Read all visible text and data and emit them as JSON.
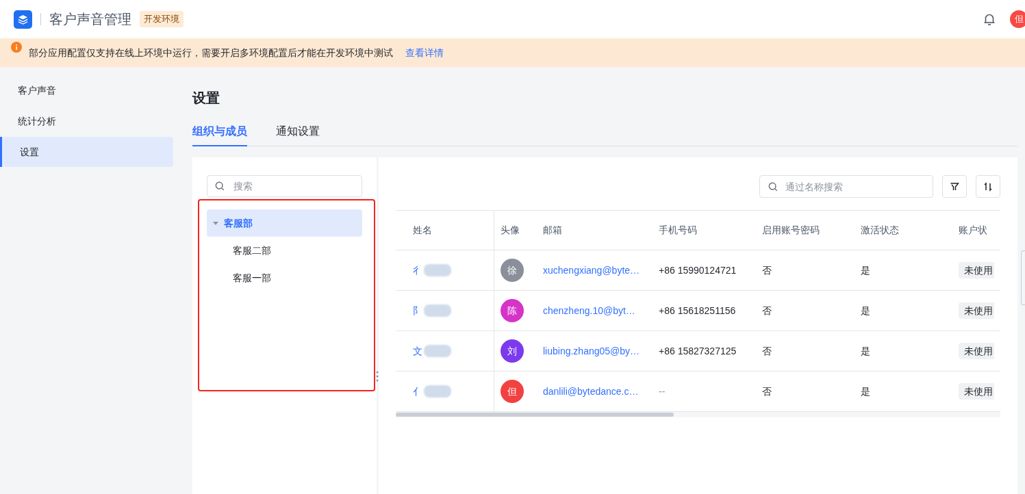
{
  "header": {
    "app_title": "客户声音管理",
    "env_badge": "开发环境",
    "avatar": "但"
  },
  "banner": {
    "message": "部分应用配置仅支持在线上环境中运行，需要开启多环境配置后才能在开发环境中测试",
    "link": "查看详情"
  },
  "sidebar": {
    "items": [
      {
        "label": "客户声音",
        "selected": false
      },
      {
        "label": "统计分析",
        "selected": false
      },
      {
        "label": "设置",
        "selected": true
      }
    ]
  },
  "page_title": "设置",
  "tabs": [
    {
      "label": "组织与成员",
      "selected": true
    },
    {
      "label": "通知设置",
      "selected": false
    }
  ],
  "tree": {
    "search_placeholder": "搜索",
    "items": [
      {
        "label": "客服部",
        "selected": true,
        "expanded": true,
        "children": [
          {
            "label": "客服二部",
            "selected": false
          },
          {
            "label": "客服一部",
            "selected": false
          }
        ]
      }
    ]
  },
  "members": {
    "search_placeholder": "通过名称搜索",
    "columns": [
      "姓名",
      "头像",
      "邮箱",
      "手机号码",
      "启用账号密码",
      "激活状态",
      "账户状"
    ],
    "rows": [
      {
        "name": "彳",
        "avatar": "徐",
        "color": "#8a8f99",
        "email": "xuchengxiang@byte…",
        "phone": "+86 15990124721",
        "password_enabled": "否",
        "activated": "是",
        "account_status": "未使用"
      },
      {
        "name": "阝",
        "avatar": "陈",
        "color": "#d633c9",
        "email": "chenzheng.10@byt…",
        "phone": "+86 15618251156",
        "password_enabled": "否",
        "activated": "是",
        "account_status": "未使用"
      },
      {
        "name": "文",
        "avatar": "刘",
        "color": "#7c3aed",
        "email": "liubing.zhang05@by…",
        "phone": "+86 15827327125",
        "password_enabled": "否",
        "activated": "是",
        "account_status": "未使用"
      },
      {
        "name": "亻",
        "avatar": "但",
        "color": "#f24141",
        "email": "danlili@bytedance.c…",
        "phone": "--",
        "password_enabled": "否",
        "activated": "是",
        "account_status": "未使用"
      }
    ]
  }
}
